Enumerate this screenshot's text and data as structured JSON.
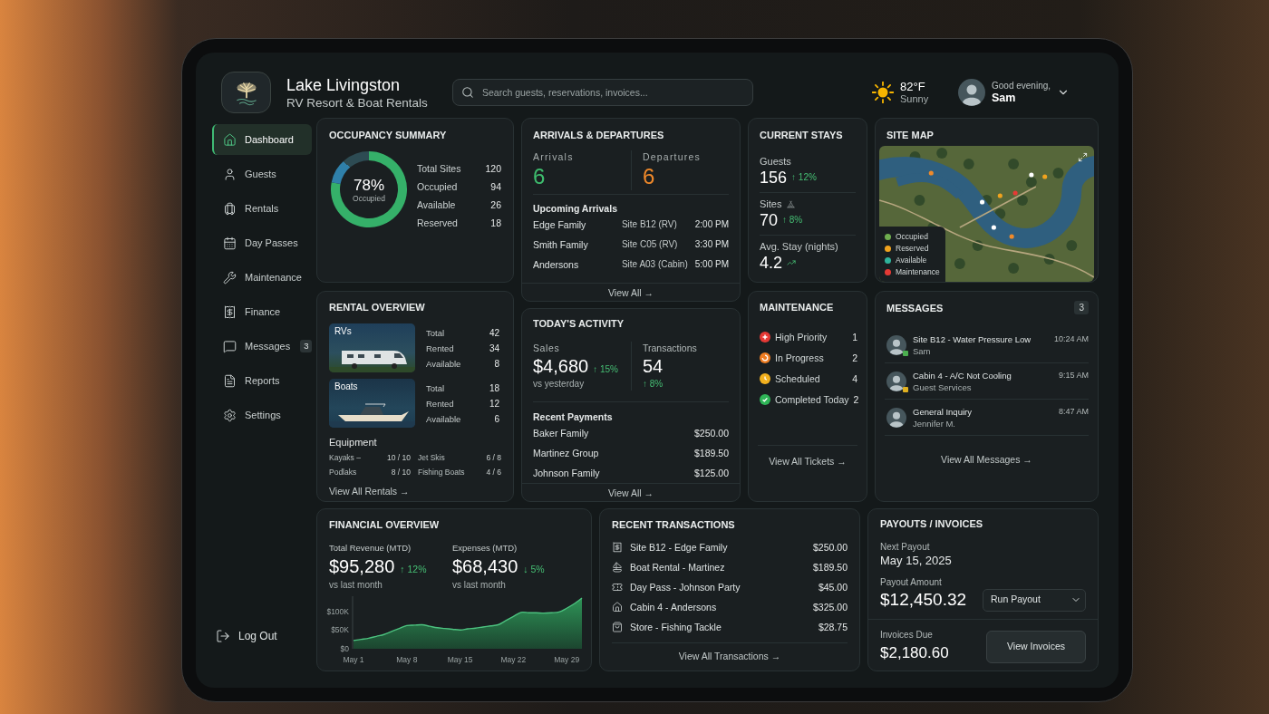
{
  "header": {
    "title": "Lake Livingston",
    "subtitle": "RV Resort & Boat Rentals",
    "search": {
      "placeholder": "Search guests, reservations, invoices..."
    },
    "weather": {
      "temperature": "82°F",
      "condition": "Sunny"
    },
    "user": {
      "greeting": "Good evening,",
      "name": "Sam"
    }
  },
  "sidebar": {
    "items": [
      {
        "label": "Dashboard",
        "selected": true
      },
      {
        "label": "Guests",
        "selected": false
      },
      {
        "label": "Rentals",
        "selected": false
      },
      {
        "label": "Day Passes",
        "selected": false
      },
      {
        "label": "Maintenance",
        "selected": false
      },
      {
        "label": "Finance",
        "selected": false
      },
      {
        "label": "Messages",
        "selected": false,
        "badge": "3"
      },
      {
        "label": "Reports",
        "selected": false
      },
      {
        "label": "Settings",
        "selected": false
      }
    ],
    "logout": "Log Out"
  },
  "occupancy": {
    "title": "OCCUPANCY SUMMARY",
    "percent": "78%",
    "caption": "Occupied",
    "chart_data": {
      "type": "donut",
      "values": [
        78,
        22
      ]
    },
    "stats": [
      {
        "label": "Total Sites",
        "value": "120"
      },
      {
        "label": "Occupied",
        "value": "94"
      },
      {
        "label": "Available",
        "value": "26"
      },
      {
        "label": "Reserved",
        "value": "18"
      }
    ]
  },
  "arrivals": {
    "title": "ARRIVALS & DEPARTURES",
    "counts": [
      {
        "label": "Arrivals",
        "value": "6",
        "color": "#3ebd6e"
      },
      {
        "label": "Departures",
        "value": "6",
        "color": "#f0892a"
      }
    ],
    "upcoming_title": "Upcoming Arrivals",
    "rows": [
      {
        "name": "Edge Family",
        "site": "Site B12 (RV)",
        "time": "2:00 PM"
      },
      {
        "name": "Smith Family",
        "site": "Site C05 (RV)",
        "time": "3:30 PM"
      },
      {
        "name": "Andersons",
        "site": "Site A03 (Cabin)",
        "time": "5:00 PM"
      }
    ],
    "link": "View All →"
  },
  "current_stays": {
    "title": "CURRENT STAYS",
    "metrics": [
      {
        "label": "Guests",
        "value": "156",
        "change": "↑ 12%"
      },
      {
        "label": "Sites",
        "value": "70",
        "change": "↑ 8%"
      },
      {
        "label": "Avg. Stay (nights)",
        "value": "4.2"
      }
    ]
  },
  "site_map": {
    "title": "SITE MAP",
    "legend": [
      {
        "label": "Occupied",
        "color": "#6fae4f"
      },
      {
        "label": "Reserved",
        "color": "#f0a31e"
      },
      {
        "label": "Available",
        "color": "#2fb39b"
      },
      {
        "label": "Maintenance",
        "color": "#e53a35"
      }
    ]
  },
  "rental_overview": {
    "title": "RENTAL OVERVIEW",
    "fleets": [
      {
        "kind": "rv",
        "label": "RVs",
        "stats": [
          {
            "label": "Total",
            "value": "42"
          },
          {
            "label": "Rented",
            "value": "34"
          },
          {
            "label": "Available",
            "value": "8"
          }
        ]
      },
      {
        "kind": "boat",
        "label": "Boats",
        "stats": [
          {
            "label": "Total",
            "value": "18"
          },
          {
            "label": "Rented",
            "value": "12"
          },
          {
            "label": "Available",
            "value": "6"
          }
        ]
      }
    ],
    "equipment_title": "Equipment",
    "equipment": [
      {
        "label": "Kayaks –",
        "value": "10 / 10"
      },
      {
        "label": "Jet Skis",
        "value": "6 / 8"
      },
      {
        "label": "Podlaks",
        "value": "8 / 10"
      },
      {
        "label": "Fishing Boats",
        "value": "4 / 6"
      }
    ],
    "link": "View All Rentals →"
  },
  "todays_activity": {
    "title": "TODAY'S ACTIVITY",
    "sales": {
      "label": "Sales",
      "value": "$4,680",
      "change": "↑ 15%",
      "note": "vs yesterday"
    },
    "transactions": {
      "label": "Transactions",
      "value": "54",
      "change": "↑ 8%"
    },
    "payments_title": "Recent Payments",
    "payments": [
      {
        "name": "Baker Family",
        "amount": "$250.00"
      },
      {
        "name": "Martinez Group",
        "amount": "$189.50"
      },
      {
        "name": "Johnson Family",
        "amount": "$125.00"
      }
    ],
    "link": "View All →"
  },
  "maintenance": {
    "title": "MAINTENANCE",
    "items": [
      {
        "label": "High Priority",
        "count": "1",
        "color": "#e53935"
      },
      {
        "label": "In Progress",
        "count": "2",
        "color": "#ef7d22"
      },
      {
        "label": "Scheduled",
        "count": "4",
        "color": "#f2b01e"
      },
      {
        "label": "Completed Today",
        "count": "2",
        "color": "#2fb457"
      }
    ],
    "link": "View All Tickets →"
  },
  "messages": {
    "title": "MESSAGES",
    "badge": "3",
    "items": [
      {
        "subject": "Site B12 - Water Pressure Low",
        "sender": "Sam",
        "time": "10:24 AM",
        "color": "#4caf50"
      },
      {
        "subject": "Cabin 4 - A/C Not Cooling",
        "sender": "Guest Services",
        "time": "9:15 AM",
        "color": "#e0b020"
      },
      {
        "subject": "General Inquiry",
        "sender": "Jennifer M.",
        "time": "8:47 AM"
      }
    ],
    "link": "View All Messages →"
  },
  "financial_overview": {
    "title": "FINANCIAL OVERVIEW",
    "metrics": [
      {
        "label": "Total Revenue (MTD)",
        "value": "$95,280",
        "change": "↑ 12%",
        "note": "vs last month"
      },
      {
        "label": "Expenses (MTD)",
        "value": "$68,430",
        "change": "↓ 5%",
        "note": "vs last month"
      }
    ],
    "chart_data": {
      "type": "area",
      "categories": [
        "May 1",
        null,
        null,
        null,
        null,
        null,
        null,
        "May 8",
        null,
        null,
        null,
        null,
        null,
        null,
        "May 15",
        null,
        null,
        null,
        null,
        null,
        null,
        "May 22",
        null,
        null,
        null,
        null,
        null,
        null,
        "May 29",
        null,
        null
      ],
      "values": [
        22,
        25,
        28,
        33,
        38,
        46,
        54,
        62,
        63,
        64,
        60,
        56,
        54,
        52,
        50,
        53,
        55,
        58,
        61,
        64,
        75,
        86,
        97,
        96,
        96,
        95,
        96,
        98,
        108,
        120,
        135
      ],
      "ylim": [
        0,
        140
      ],
      "yticks": [
        {
          "value": 0,
          "label": "$0"
        },
        {
          "value": 50,
          "label": "$50K"
        },
        {
          "value": 100,
          "label": "$100K"
        }
      ]
    }
  },
  "recent_transactions": {
    "title": "RECENT TRANSACTIONS",
    "rows": [
      {
        "label": "Site B12 - Edge Family",
        "amount": "$250.00"
      },
      {
        "label": "Boat Rental - Martinez",
        "amount": "$189.50"
      },
      {
        "label": "Day Pass - Johnson Party",
        "amount": "$45.00"
      },
      {
        "label": "Cabin 4 - Andersons",
        "amount": "$325.00"
      },
      {
        "label": "Store - Fishing Tackle",
        "amount": "$28.75"
      }
    ],
    "link": "View All Transactions →"
  },
  "payouts": {
    "title": "PAYOUTS / INVOICES",
    "next_payout_label": "Next Payout",
    "next_payout": "May 15, 2025",
    "amount_label": "Payout Amount",
    "amount": "$12,450.32",
    "action": "Run Payout",
    "invoices_label": "Invoices Due",
    "invoices": "$2,180.60",
    "invoices_button": "View Invoices"
  }
}
